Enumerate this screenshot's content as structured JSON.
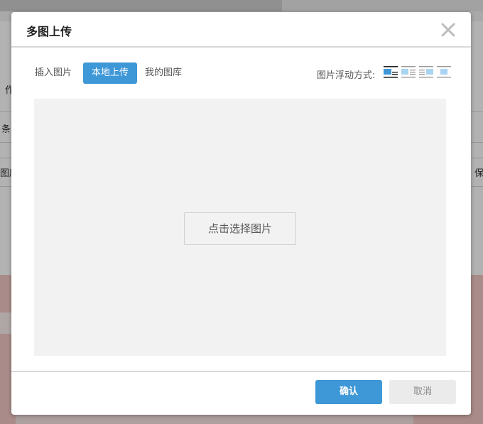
{
  "background": {
    "fragments": [
      "作",
      "条",
      "图库",
      "保"
    ]
  },
  "dialog": {
    "title": "多图上传",
    "tabs": [
      {
        "label": "插入图片",
        "active": false
      },
      {
        "label": "本地上传",
        "active": true
      },
      {
        "label": "我的图库",
        "active": false
      }
    ],
    "float_label": "图片浮动方式:",
    "float_options": [
      "float-none-icon",
      "float-left-icon",
      "float-right-icon",
      "float-center-icon"
    ],
    "upload": {
      "choose_label": "点击选择图片"
    },
    "footer": {
      "confirm_label": "确认",
      "cancel_label": "取消"
    }
  },
  "colors": {
    "accent": "#3e97d6",
    "cancel_bg": "#ebebeb",
    "upload_bg": "#f2f2f2"
  }
}
